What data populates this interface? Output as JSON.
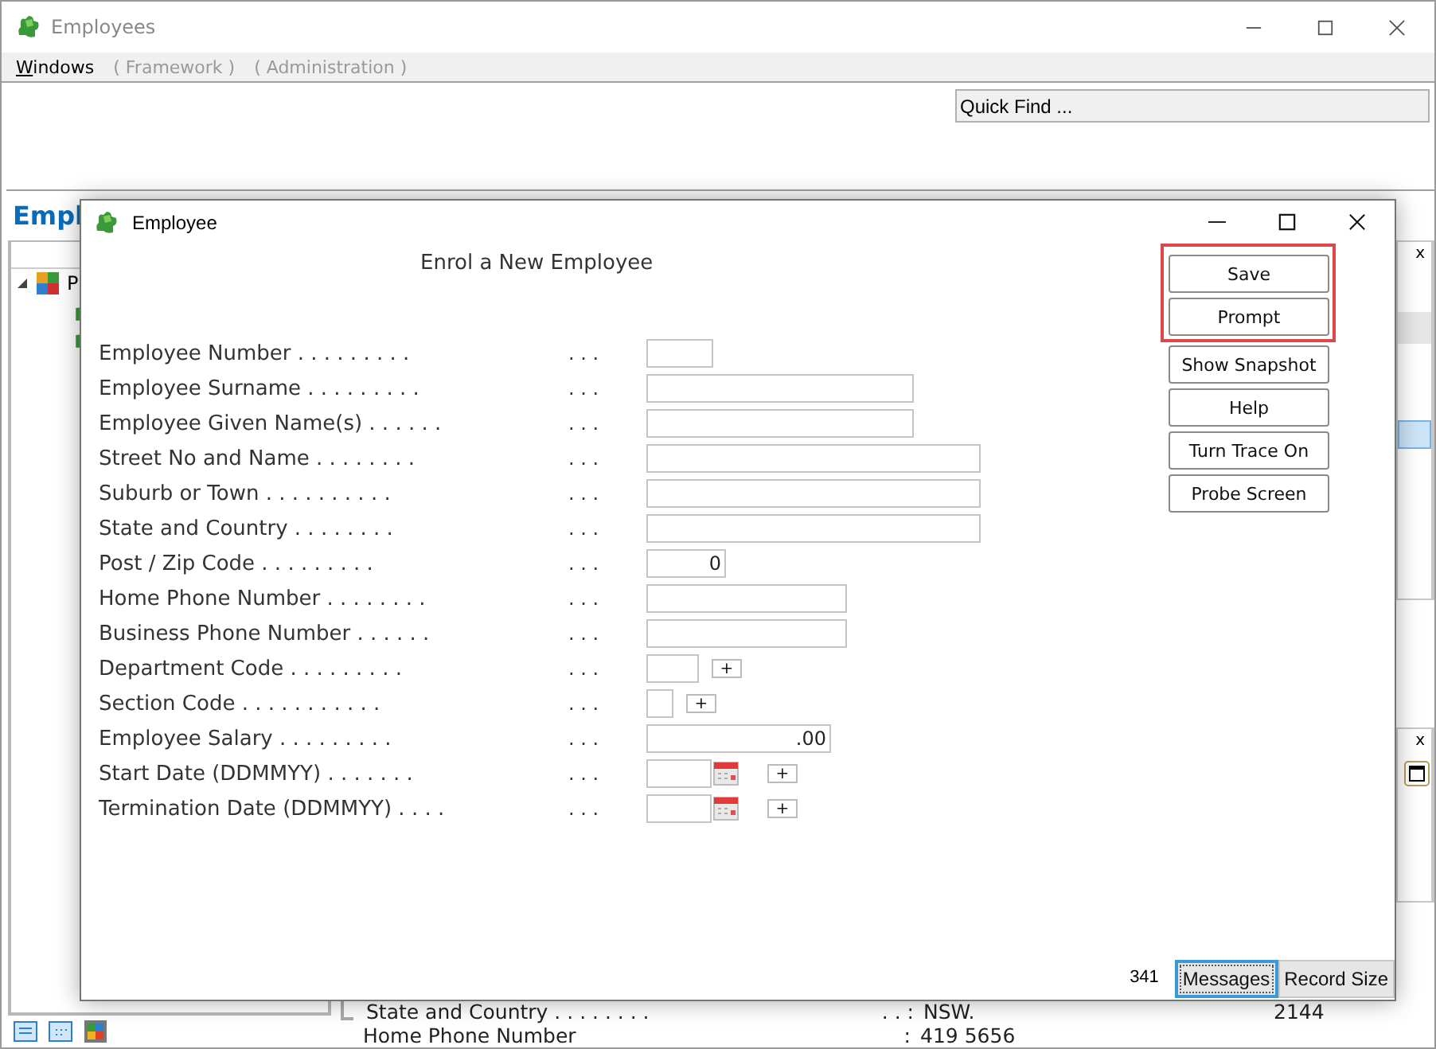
{
  "app": {
    "title": "Employees",
    "menu": [
      {
        "label": "Windows",
        "disabled": false
      },
      {
        "label": "( Framework )",
        "disabled": true
      },
      {
        "label": "( Administration )",
        "disabled": true
      }
    ],
    "quick_find": "Quick Find ...",
    "heading": "Empl",
    "tree": [
      {
        "label": "P",
        "expanded": true
      }
    ],
    "side_panels": [
      {
        "close": "x"
      },
      {
        "close": "x"
      }
    ],
    "background_rows": [
      {
        "label": "State and Country . . . . . . . .",
        "separator": ". . :",
        "value": "NSW.",
        "extra": "2144"
      },
      {
        "label": "Home Phone Number",
        "separator": ":",
        "value": "419 5656"
      }
    ]
  },
  "dialog": {
    "title": "Employee",
    "heading": "Enrol a New Employee",
    "fields": [
      {
        "label": "Employee Number . . . . . . . . .",
        "leader": ". . .",
        "kind": "short"
      },
      {
        "label": "Employee Surname . . . . . . . . .",
        "leader": ". . .",
        "kind": "name"
      },
      {
        "label": "Employee Given Name(s) . . . . . .",
        "leader": ". . .",
        "kind": "name"
      },
      {
        "label": "Street No and Name . . . . . . . .",
        "leader": ". . .",
        "kind": "long"
      },
      {
        "label": "Suburb or Town . . . . . . . . . .",
        "leader": ". . .",
        "kind": "long"
      },
      {
        "label": "State and Country . . . . . . . .",
        "leader": ". . .",
        "kind": "long"
      },
      {
        "label": "Post / Zip Code . . . . . . . . .",
        "leader": ". . .",
        "kind": "number",
        "value": "0"
      },
      {
        "label": "Home Phone Number . . . . . . . .",
        "leader": ". . .",
        "kind": "phone"
      },
      {
        "label": "Business Phone Number . . . . . .",
        "leader": ". . .",
        "kind": "phone"
      },
      {
        "label": "Department Code . . . . . . . . .",
        "leader": ". . .",
        "kind": "code",
        "lookup": "+"
      },
      {
        "label": "Section Code . . . . . . . . . . .",
        "leader": ". . .",
        "kind": "tiny",
        "lookup": "+"
      },
      {
        "label": "Employee Salary . . . . . . . . .",
        "leader": ". . .",
        "kind": "money",
        "value": ".00"
      },
      {
        "label": "Start Date (DDMMYY) . . . . . . .",
        "leader": ". . .",
        "kind": "date",
        "lookup": "+"
      },
      {
        "label": "Termination Date (DDMMYY) . . . .",
        "leader": ". . .",
        "kind": "date",
        "lookup": "+"
      }
    ],
    "framed_buttons": [
      "Save",
      "Prompt"
    ],
    "buttons": [
      "Show Snapshot",
      "Help",
      "Turn Trace On",
      "Probe Screen"
    ],
    "footer": {
      "counter": "341",
      "tabs": [
        {
          "label": "Messages",
          "selected": true
        },
        {
          "label": "Record Size",
          "selected": false
        }
      ]
    }
  }
}
